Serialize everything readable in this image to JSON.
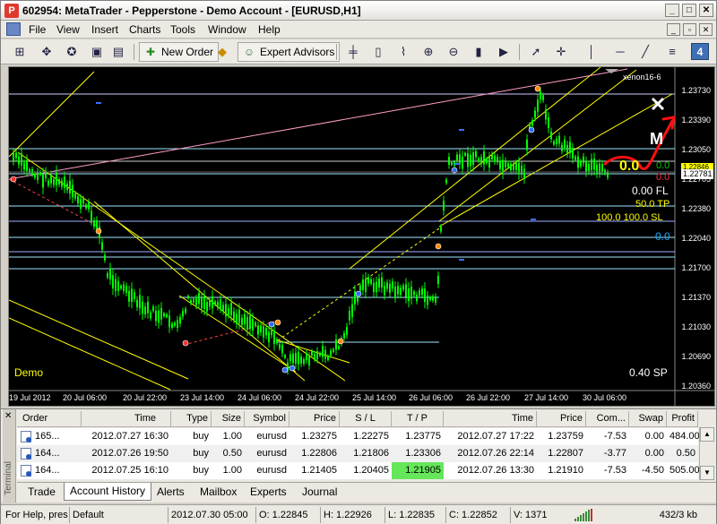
{
  "window": {
    "title": "602954: MetaTrader - Pepperstone - Demo Account - [EURUSD,H1]",
    "app_icon": "P",
    "minimize": "_",
    "maximize": "□",
    "close": "✕"
  },
  "menu": {
    "items": [
      "File",
      "View",
      "Insert",
      "Charts",
      "Tools",
      "Window",
      "Help"
    ],
    "mdi_min": "_",
    "mdi_restore": "▫",
    "mdi_close": "✕"
  },
  "toolbar": {
    "new_order": "New Order",
    "expert_advisors": "Expert Advisors",
    "badge": "4"
  },
  "chart": {
    "indicator_label": "xenon16-6",
    "prices": [
      "1.23730",
      "1.23390",
      "1.23050",
      "1.22705",
      "1.22380",
      "1.22040",
      "1.21700",
      "1.21370",
      "1.21030",
      "1.20690",
      "1.20360"
    ],
    "current_price_top": "1.22846",
    "current_price": "1.22781",
    "times": [
      "19 Jul 2012",
      "20 Jul 06:00",
      "20 Jul 22:00",
      "23 Jul 14:00",
      "24 Jul 06:00",
      "24 Jul 22:00",
      "25 Jul 14:00",
      "26 Jul 06:00",
      "26 Jul 22:00",
      "27 Jul 14:00",
      "30 Jul 06:00"
    ],
    "overlay": {
      "big_zero": "0.0",
      "green_zero": "0.0",
      "red_zero": "0.0",
      "fl": "0.00 FL",
      "tp": "50.0 TP",
      "sl": "100.0 100.0 SL",
      "cyan_zero": "0.0",
      "m_label": "M",
      "demo": "Demo",
      "spread": "0.40 SP"
    },
    "colors": {
      "bull": "#00ff00",
      "bear": "#00ff00",
      "line_yellow": "#ffff00",
      "line_cyan": "#9ee8ff"
    }
  },
  "terminal": {
    "label": "Terminal",
    "close": "✕",
    "columns": [
      "Order",
      "Time",
      "Type",
      "Size",
      "Symbol",
      "Price",
      "S / L",
      "T / P",
      "Time",
      "Price",
      "Com...",
      "Swap",
      "Profit"
    ],
    "rows": [
      [
        "165...",
        "2012.07.27 16:30",
        "buy",
        "1.00",
        "eurusd",
        "1.23275",
        "1.22275",
        "1.23775",
        "2012.07.27 17:22",
        "1.23759",
        "-7.53",
        "0.00",
        "484.00"
      ],
      [
        "164...",
        "2012.07.26 19:50",
        "buy",
        "0.50",
        "eurusd",
        "1.22806",
        "1.21806",
        "1.23306",
        "2012.07.26 22:14",
        "1.22807",
        "-3.77",
        "0.00",
        "0.50"
      ],
      [
        "164...",
        "2012.07.25 16:10",
        "buy",
        "1.00",
        "eurusd",
        "1.21405",
        "1.20405",
        "1.21905",
        "2012.07.26 13:30",
        "1.21910",
        "-7.53",
        "-4.50",
        "505.00"
      ]
    ],
    "tabs": [
      "Trade",
      "Account History",
      "Alerts",
      "Mailbox",
      "Experts",
      "Journal"
    ],
    "active_tab": "Account History"
  },
  "status": {
    "help": "For Help, pres",
    "profile": "Default",
    "datetime": "2012.07.30 05:00",
    "open": "O: 1.22845",
    "high": "H: 1.22926",
    "low": "L: 1.22835",
    "close": "C: 1.22852",
    "volume": "V: 1371",
    "traffic": "432/3 kb"
  }
}
